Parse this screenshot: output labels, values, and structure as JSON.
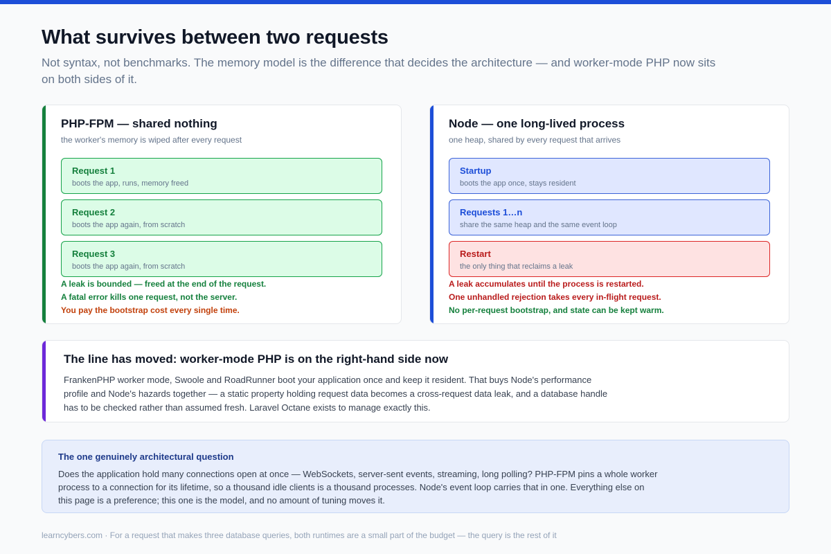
{
  "header": {
    "title": "What survives between two requests",
    "subtitle": "Not syntax, not benchmarks. The memory model is the difference that decides the architecture — and worker-mode PHP now sits on both sides of it."
  },
  "colors": {
    "accent_blue": "#1d4ed8",
    "php_green": "#15803d",
    "node_blue": "#1d4ed8",
    "worker_purple": "#6d28d9",
    "danger_red": "#b91c1c",
    "warn_orange": "#c2410c"
  },
  "php_card": {
    "title": "PHP-FPM — shared nothing",
    "subtitle": "the worker's memory is wiped after every request",
    "steps": [
      {
        "label": "Request 1",
        "desc": "boots the app, runs, memory freed"
      },
      {
        "label": "Request 2",
        "desc": "boots the app again, from scratch"
      },
      {
        "label": "Request 3",
        "desc": "boots the app again, from scratch"
      }
    ],
    "notes": [
      "A leak is bounded — freed at the end of the request.",
      "A fatal error kills one request, not the server.",
      "You pay the bootstrap cost every single time."
    ]
  },
  "node_card": {
    "title": "Node — one long-lived process",
    "subtitle": "one heap, shared by every request that arrives",
    "steps": [
      {
        "label": "Startup",
        "desc": "boots the app once, stays resident"
      },
      {
        "label": "Requests 1…n",
        "desc": "share the same heap and the same event loop"
      },
      {
        "label": "Restart",
        "desc": "the only thing that reclaims a leak"
      }
    ],
    "notes": [
      "A leak accumulates until the process is restarted.",
      "One unhandled rejection takes every in-flight request.",
      "No per-request bootstrap, and state can be kept warm."
    ]
  },
  "worker_card": {
    "title": "The line has moved: worker-mode PHP is on the right-hand side now",
    "body": "FrankenPHP worker mode, Swoole and RoadRunner boot your application once and keep it resident. That buys Node's performance profile and Node's hazards together — a static property holding request data becomes a cross-request data leak, and a database handle has to be checked rather than assumed fresh. Laravel Octane exists to manage exactly this."
  },
  "callout": {
    "title": "The one genuinely architectural question",
    "body": "Does the application hold many connections open at once — WebSockets, server-sent events, streaming, long polling? PHP-FPM pins a whole worker process to a connection for its lifetime, so a thousand idle clients is a thousand processes. Node's event loop carries that in one. Everything else on this page is a preference; this one is the model, and no amount of tuning moves it."
  },
  "footer": {
    "text": "learncybers.com · For a request that makes three database queries, both runtimes are a small part of the budget — the query is the rest of it"
  }
}
